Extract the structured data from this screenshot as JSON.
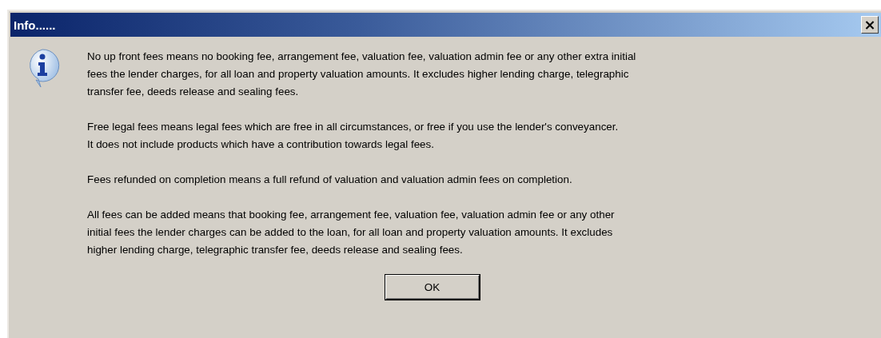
{
  "window": {
    "title": "Info......",
    "close": "×"
  },
  "paragraphs": [
    {
      "lines": [
        "No up front fees means no booking fee, arrangement fee, valuation fee, valuation admin fee or any other extra initial",
        "fees the lender charges, for all loan and property valuation amounts. It excludes higher lending charge, telegraphic",
        "transfer fee, deeds release and sealing fees."
      ]
    },
    {
      "lines": [
        "Free legal fees means legal fees which are free in all circumstances, or free if you use the lender's conveyancer.",
        "It does not include products which have a contribution towards legal fees."
      ]
    },
    {
      "lines": [
        "Fees refunded on completion means a full refund of valuation and valuation admin fees on completion."
      ]
    },
    {
      "lines": [
        "All fees can be added means that booking fee, arrangement fee, valuation fee, valuation admin fee or any other",
        "initial fees the lender charges can be added to the loan, for all loan and property valuation amounts. It excludes",
        "higher lending charge, telegraphic transfer fee, deeds release and sealing fees."
      ]
    }
  ],
  "buttons": [
    {
      "label": "OK"
    }
  ]
}
